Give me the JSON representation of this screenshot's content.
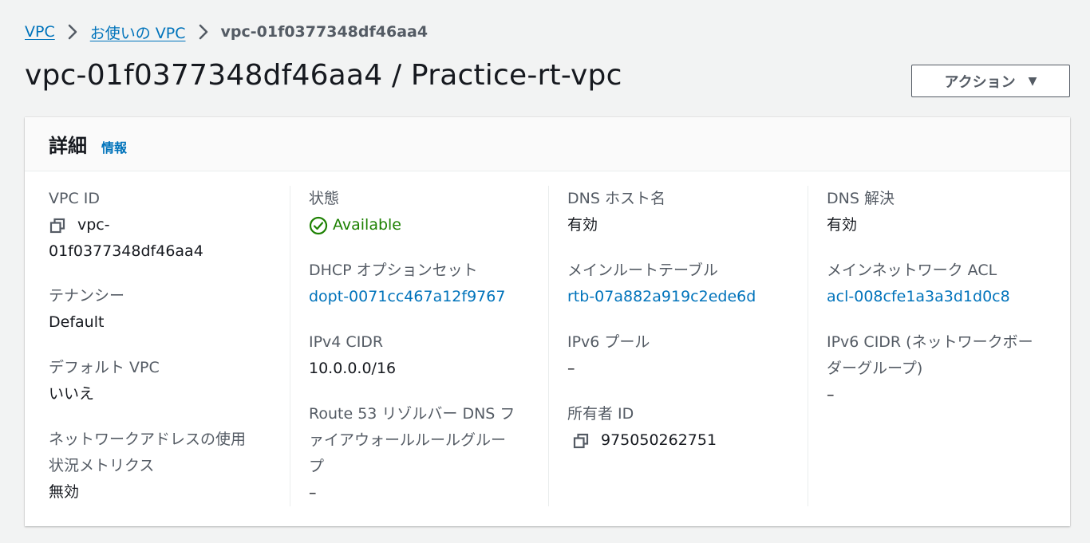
{
  "breadcrumb": {
    "items": [
      "VPC",
      "お使いの VPC"
    ],
    "current": "vpc-01f0377348df46aa4"
  },
  "page": {
    "title": "vpc-01f0377348df46aa4 / Practice-rt-vpc",
    "action_label": "アクション"
  },
  "panel": {
    "title": "詳細",
    "info_link": "情報"
  },
  "details": {
    "vpc_id": {
      "label": "VPC ID",
      "value_line1": "vpc-",
      "value_line2": "01f0377348df46aa4"
    },
    "tenancy": {
      "label": "テナンシー",
      "value": "Default"
    },
    "default_vpc": {
      "label": "デフォルト VPC",
      "value": "いいえ"
    },
    "network_address_usage": {
      "label_line1": "ネットワークアドレスの使用",
      "label_line2": "状況メトリクス",
      "value": "無効"
    },
    "state": {
      "label": "状態",
      "value": "Available"
    },
    "dhcp_options": {
      "label": "DHCP オプションセット",
      "value": "dopt-0071cc467a12f9767"
    },
    "ipv4_cidr": {
      "label": "IPv4 CIDR",
      "value": "10.0.0.0/16"
    },
    "route53": {
      "label_line1": "Route 53 リゾルバー DNS フ",
      "label_line2": "ァイアウォールルールグルー",
      "label_line3": "プ",
      "value": "–"
    },
    "dns_hostnames": {
      "label": "DNS ホスト名",
      "value": "有効"
    },
    "main_route_table": {
      "label": "メインルートテーブル",
      "value": "rtb-07a882a919c2ede6d"
    },
    "ipv6_pool": {
      "label": "IPv6 プール",
      "value": "–"
    },
    "owner_id": {
      "label": "所有者 ID",
      "value": "975050262751"
    },
    "dns_resolution": {
      "label": "DNS 解決",
      "value": "有効"
    },
    "main_network_acl": {
      "label": "メインネットワーク ACL",
      "value": "acl-008cfe1a3a3d1d0c8"
    },
    "ipv6_cidr": {
      "label_line1": "IPv6 CIDR (ネットワークボー",
      "label_line2": "ダーグループ)",
      "value": "–"
    }
  },
  "colors": {
    "link": "#0073bb",
    "success": "#1d8102",
    "text": "#16191f",
    "label": "#545b64",
    "background": "#f2f3f3"
  },
  "icons": {
    "breadcrumb_separator": "chevron-right-icon",
    "copy": "copy-icon",
    "status": "check-circle-icon",
    "dropdown": "caret-down-icon"
  }
}
